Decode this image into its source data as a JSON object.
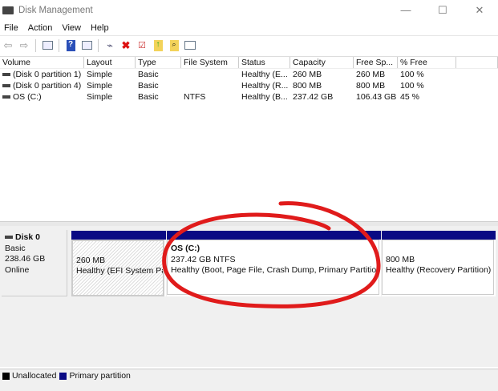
{
  "window": {
    "title": "Disk Management",
    "min": "—",
    "max": "☐",
    "close": "✕"
  },
  "menu": [
    "File",
    "Action",
    "View",
    "Help"
  ],
  "toolbar_icons": [
    "back-icon",
    "forward-icon",
    "console-tree-icon",
    "help-icon",
    "action-pane-icon",
    "connect-icon",
    "delete-icon",
    "check-icon",
    "rescan-icon",
    "search-icon",
    "properties-icon"
  ],
  "columns": [
    "Volume",
    "Layout",
    "Type",
    "File System",
    "Status",
    "Capacity",
    "Free Sp...",
    "% Free",
    ""
  ],
  "rows": [
    [
      "(Disk 0 partition 1)",
      "Simple",
      "Basic",
      "",
      "Healthy (E...",
      "260 MB",
      "260 MB",
      "100 %"
    ],
    [
      "(Disk 0 partition 4)",
      "Simple",
      "Basic",
      "",
      "Healthy (R...",
      "800 MB",
      "800 MB",
      "100 %"
    ],
    [
      "OS (C:)",
      "Simple",
      "Basic",
      "NTFS",
      "Healthy (B...",
      "237.42 GB",
      "106.43 GB",
      "45 %"
    ]
  ],
  "disk": {
    "name": "Disk 0",
    "type": "Basic",
    "size": "238.46 GB",
    "status": "Online"
  },
  "partitions": [
    {
      "title": "",
      "size": "260 MB",
      "status": "Healthy (EFI System Partition)"
    },
    {
      "title": "OS  (C:)",
      "size": "237.42 GB NTFS",
      "status": "Healthy (Boot, Page File, Crash Dump, Primary Partition)"
    },
    {
      "title": "",
      "size": "800 MB",
      "status": "Healthy (Recovery Partition)"
    }
  ],
  "legend": [
    {
      "label": "Unallocated",
      "color": "#000000"
    },
    {
      "label": "Primary partition",
      "color": "#0a0a84"
    }
  ],
  "annotation_color": "#e01b1b"
}
